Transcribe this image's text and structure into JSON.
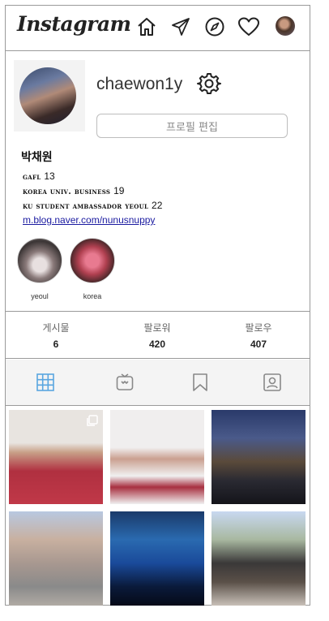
{
  "header": {
    "logo_text": "Instagram",
    "icons": [
      "home-icon",
      "paper-plane-icon",
      "compass-icon",
      "heart-icon",
      "avatar"
    ]
  },
  "profile": {
    "username": "chaewon1y",
    "edit_button": "프로필 편집",
    "real_name": "박채원",
    "bio": [
      {
        "text": "gafl",
        "num": "13"
      },
      {
        "text": "korea univ. business",
        "num": "19"
      },
      {
        "text": "ku student ambassador yeoul",
        "num": "22"
      }
    ],
    "link": "m.blog.naver.com/nunusnuppy",
    "highlights": [
      {
        "label": "yeoul"
      },
      {
        "label": "korea"
      }
    ]
  },
  "stats": [
    {
      "label": "게시물",
      "value": "6"
    },
    {
      "label": "팔로워",
      "value": "420"
    },
    {
      "label": "팔로우",
      "value": "407"
    }
  ],
  "tabs": [
    "grid-icon",
    "igtv-icon",
    "bookmark-icon",
    "tagged-icon"
  ],
  "colors": {
    "border": "#9a9a9a",
    "active_tab": "#5aa6e0",
    "inactive_tab": "#888888",
    "link": "#1a1aa0"
  }
}
